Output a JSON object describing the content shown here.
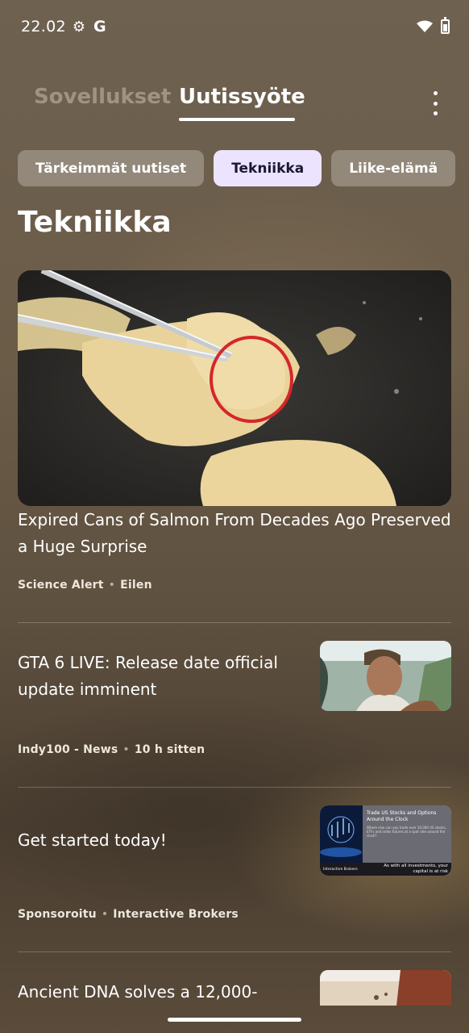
{
  "status_bar": {
    "time": "22.02",
    "google_label": "G"
  },
  "header": {
    "tab_apps": "Sovellukset",
    "tab_feed": "Uutissyöte"
  },
  "chips": [
    "Tärkeimmät uutiset",
    "Tekniikka",
    "Liike-elämä"
  ],
  "active_chip_index": 1,
  "section_title": "Tekniikka",
  "articles": [
    {
      "title": "Expired Cans of Salmon From Decades Ago Preserved a Huge Surprise",
      "source": "Science Alert",
      "time": "Eilen"
    },
    {
      "title": "GTA 6 LIVE: Release date official update imminent",
      "source": "Indy100 - News",
      "time": "10 h sitten"
    },
    {
      "title": "Get started today!",
      "source": "Sponsoroitu",
      "time": "Interactive Brokers"
    },
    {
      "title": "Ancient DNA solves a 12,000-"
    }
  ],
  "ad_thumb": {
    "headline": "Trade US Stocks and Options Around the Clock",
    "body": "Where else can you trade over 10,000 US stocks, ETFs and index futures at a spot rate around the clock?",
    "brand": "Interactive Brokers",
    "disclaimer": "As with all investments, your capital is at risk"
  }
}
